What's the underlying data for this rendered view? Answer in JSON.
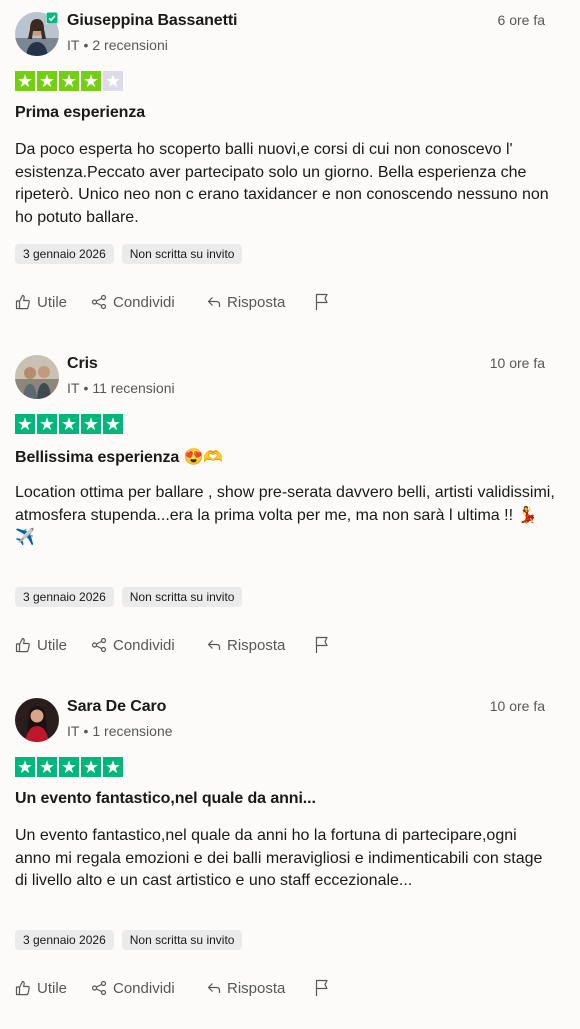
{
  "reviews": [
    {
      "name": "Giuseppina Bassanetti",
      "country": "IT",
      "review_count": "2 recensioni",
      "time": "6 ore fa",
      "rating": 4,
      "title": "Prima esperienza",
      "body": "Da poco esperta ho scoperto balli nuovi,e corsi di cui non conoscevo l' esistenza.Peccato aver partecipato solo un giorno. Bella esperienza che ripeterò. Unico neo non c erano taxidancer e non conoscendo nessuno non ho potuto ballare.",
      "date": "3 gennaio 2026",
      "invite_tag": "Non scritta su invito",
      "verified": true
    },
    {
      "name": "Cris",
      "country": "IT",
      "review_count": "11 recensioni",
      "time": "10 ore fa",
      "rating": 5,
      "title": "Bellissima esperienza 😍🫶",
      "body": "Location ottima per ballare , show pre-serata davvero belli, artisti validissimi, atmosfera stupenda...era la prima volta per me, ma non sarà l ultima !! 💃✈️",
      "date": "3 gennaio 2026",
      "invite_tag": "Non scritta su invito",
      "verified": false
    },
    {
      "name": "Sara De Caro",
      "country": "IT",
      "review_count": "1 recensione",
      "time": "10 ore fa",
      "rating": 5,
      "title": "Un evento fantastico,nel quale da anni...",
      "body": "Un evento fantastico,nel quale da anni ho la fortuna di partecipare,ogni anno mi regala emozioni e dei balli meravigliosi e indimenticabili con stage di livello alto e un cast artistico e uno staff eccezionale...",
      "date": "3 gennaio 2026",
      "invite_tag": "Non scritta su invito",
      "verified": false
    }
  ],
  "actions": {
    "useful": "Utile",
    "share": "Condividi",
    "reply": "Risposta"
  },
  "colors": {
    "star_4": "#73cf11",
    "star_5": "#00b67a",
    "star_empty": "#dcdce6",
    "verified": "#00b67a"
  },
  "icons": [
    "thumbs-up-icon",
    "share-icon",
    "reply-icon",
    "flag-icon",
    "star-icon",
    "verified-badge-icon"
  ]
}
